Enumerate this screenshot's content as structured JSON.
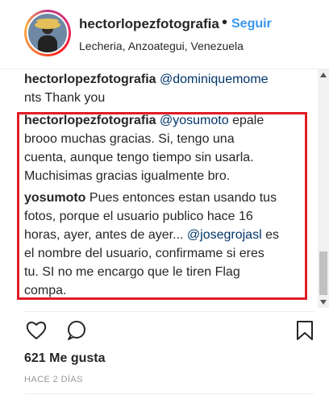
{
  "header": {
    "username": "hectorlopezfotografia",
    "separator": "•",
    "follow_label": "Seguir",
    "location": "Lecheria, Anzoategui, Venezuela"
  },
  "comments": [
    {
      "user": "hectorlopezfotografia",
      "mention": "@dominiquemome",
      "text_line2": "nts Thank you"
    },
    {
      "user": "hectorlopezfotografia",
      "mention": "@yosumoto",
      "line1_rest": " epale",
      "line2": "brooo muchas gracias. Si, tengo una",
      "line3": "cuenta, aunque tengo tiempo sin usarla.",
      "line4": "Muchisimas gracias igualmente bro."
    },
    {
      "user": "yosumoto",
      "line1_rest": " Pues entonces estan usando tus",
      "line2": "fotos, porque el usuario publico hace 16",
      "line3_start": "horas, ayer, antes de ayer... ",
      "mention": "@josegrojasl",
      "line3_end": " es",
      "line4": "el nombre del usuario, confirmame si eres",
      "line5": "tu. SI no me encargo que le tiren Flag",
      "line6": "compa."
    }
  ],
  "actions": {
    "heart": "heart-icon",
    "comment": "comment-icon",
    "save": "bookmark-icon"
  },
  "post": {
    "likes": "621 Me gusta",
    "time_ago": "HACE 2 DÍAS"
  },
  "colors": {
    "link_blue": "#3897f0",
    "mention_blue": "#003569",
    "highlight_red": "#e01d25",
    "text": "#262626"
  }
}
